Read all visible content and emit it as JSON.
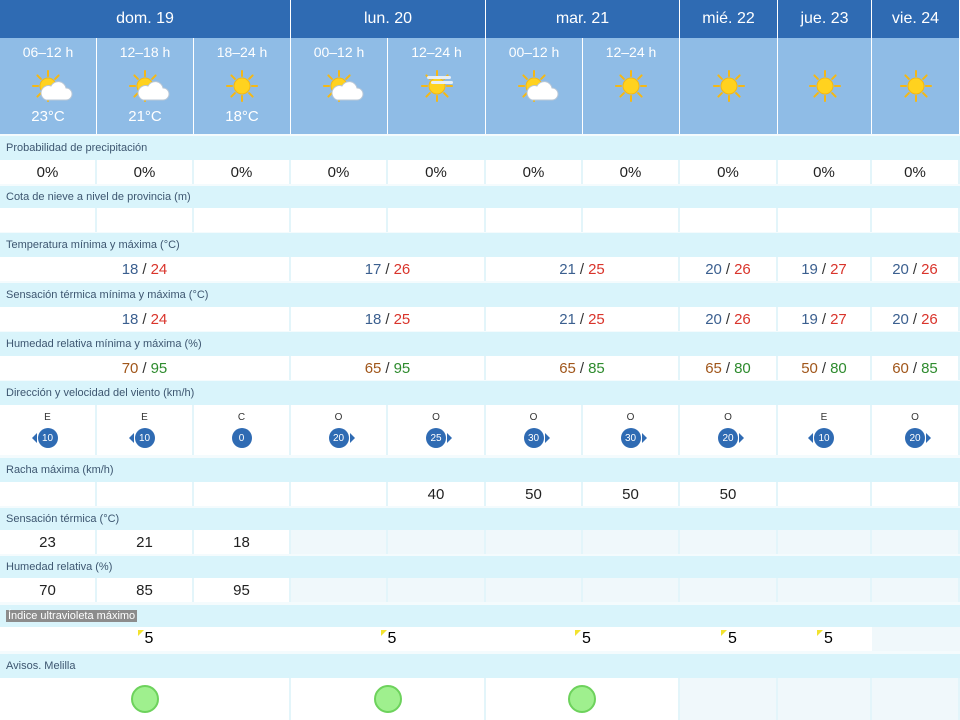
{
  "days": [
    {
      "label": "dom. 19"
    },
    {
      "label": "lun. 20"
    },
    {
      "label": "mar. 21"
    },
    {
      "label": "mié. 22"
    },
    {
      "label": "jue. 23"
    },
    {
      "label": "vie. 24"
    }
  ],
  "periods": [
    {
      "label": "06–12 h",
      "icon": "sun-cloud-icon",
      "temp": "23°C"
    },
    {
      "label": "12–18 h",
      "icon": "sun-cloud-icon",
      "temp": "21°C"
    },
    {
      "label": "18–24 h",
      "icon": "sun-icon",
      "temp": "18°C"
    },
    {
      "label": "00–12 h",
      "icon": "sun-cloud-icon",
      "temp": ""
    },
    {
      "label": "12–24 h",
      "icon": "sun-haze-icon",
      "temp": ""
    },
    {
      "label": "00–12 h",
      "icon": "sun-cloud-icon",
      "temp": ""
    },
    {
      "label": "12–24 h",
      "icon": "sun-icon",
      "temp": ""
    },
    {
      "label": "",
      "icon": "sun-icon",
      "temp": ""
    },
    {
      "label": "",
      "icon": "sun-icon",
      "temp": ""
    },
    {
      "label": "",
      "icon": "sun-icon",
      "temp": ""
    }
  ],
  "sections": {
    "precip": "Probabilidad de precipitación",
    "snow": "Cota de nieve a nivel de provincia (m)",
    "temp": "Temperatura mínima y máxima (°C)",
    "feel": "Sensación térmica mínima y máxima (°C)",
    "hum": "Humedad relativa mínima y máxima (%)",
    "wind": "Dirección y velocidad del viento (km/h)",
    "gust": "Racha máxima (km/h)",
    "feel_now": "Sensación térmica (°C)",
    "hum_now": "Humedad relativa (%)",
    "uv": "Índice ultravioleta máximo",
    "alerts": "Avisos. Melilla"
  },
  "precip": [
    "0%",
    "0%",
    "0%",
    "0%",
    "0%",
    "0%",
    "0%",
    "0%",
    "0%",
    "0%"
  ],
  "temp_minmax": [
    {
      "min": "18",
      "max": "24"
    },
    {
      "min": "17",
      "max": "26"
    },
    {
      "min": "21",
      "max": "25"
    },
    {
      "min": "20",
      "max": "26"
    },
    {
      "min": "19",
      "max": "27"
    },
    {
      "min": "20",
      "max": "26"
    }
  ],
  "feel_minmax": [
    {
      "min": "18",
      "max": "24"
    },
    {
      "min": "18",
      "max": "25"
    },
    {
      "min": "21",
      "max": "25"
    },
    {
      "min": "20",
      "max": "26"
    },
    {
      "min": "19",
      "max": "27"
    },
    {
      "min": "20",
      "max": "26"
    }
  ],
  "hum_minmax": [
    {
      "min": "70",
      "max": "95"
    },
    {
      "min": "65",
      "max": "95"
    },
    {
      "min": "65",
      "max": "85"
    },
    {
      "min": "65",
      "max": "80"
    },
    {
      "min": "50",
      "max": "80"
    },
    {
      "min": "60",
      "max": "85"
    }
  ],
  "wind": [
    {
      "dir": "E",
      "speed": "10",
      "arrow": "left"
    },
    {
      "dir": "E",
      "speed": "10",
      "arrow": "left"
    },
    {
      "dir": "C",
      "speed": "0",
      "arrow": "none"
    },
    {
      "dir": "O",
      "speed": "20",
      "arrow": "right"
    },
    {
      "dir": "O",
      "speed": "25",
      "arrow": "right"
    },
    {
      "dir": "O",
      "speed": "30",
      "arrow": "right"
    },
    {
      "dir": "O",
      "speed": "30",
      "arrow": "right"
    },
    {
      "dir": "O",
      "speed": "20",
      "arrow": "right"
    },
    {
      "dir": "E",
      "speed": "10",
      "arrow": "left"
    },
    {
      "dir": "O",
      "speed": "20",
      "arrow": "right"
    }
  ],
  "gust": [
    "",
    "",
    "",
    "",
    "40",
    "50",
    "50",
    "50",
    "",
    ""
  ],
  "feel_now": [
    "23",
    "21",
    "18"
  ],
  "hum_now": [
    "70",
    "85",
    "95"
  ],
  "uv": [
    "5",
    "5",
    "5",
    "5",
    "5"
  ],
  "colors": {
    "header": "#2f6bb3",
    "period": "#8fbce6",
    "band": "#d9f4fb",
    "alert_green": "#9ff08e"
  }
}
